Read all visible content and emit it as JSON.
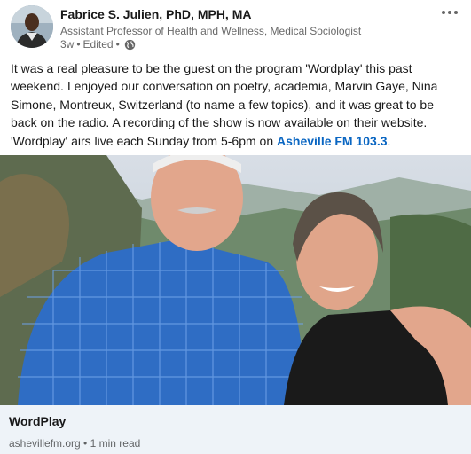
{
  "author": {
    "name": "Fabrice S. Julien, PhD, MPH, MA",
    "headline": "Assistant Professor of Health and Wellness, Medical Sociologist",
    "age": "3w",
    "edited": "Edited",
    "sep1": "•",
    "sep2": "•",
    "visibility_icon": "globe-icon",
    "more_icon": "more-options-icon"
  },
  "post": {
    "text_main": "It was a real pleasure to be the guest on the program 'Wordplay' this past weekend. I enjoyed our conversation on poetry, academia, Marvin Gaye, Nina Simone, Montreux, Switzerland (to name a few topics), and it was great to be back on the radio.  A recording of the show is now available on their website. 'Wordplay' airs live each Sunday from 5-6pm on ",
    "link_text": "Asheville FM 103.3",
    "text_end": "."
  },
  "preview": {
    "title": "WordPlay",
    "source": "ashevillefm.org",
    "sep": "•",
    "read_time": "1 min read"
  },
  "colors": {
    "link": "#0a66c2",
    "preview_bg": "#eef3f8"
  }
}
